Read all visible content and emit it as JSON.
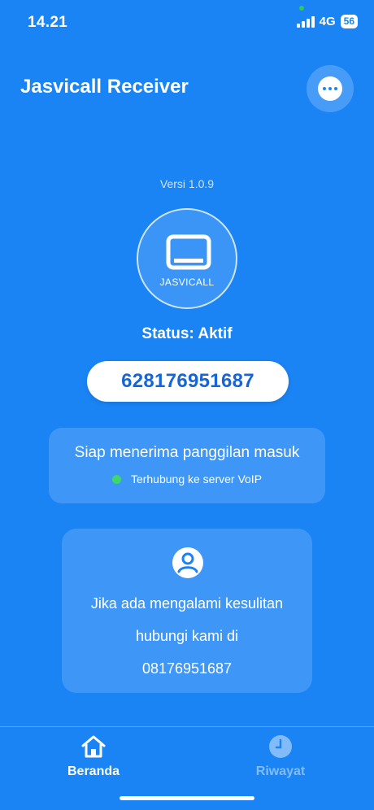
{
  "status_bar": {
    "time": "14.21",
    "network": "4G",
    "battery": "56"
  },
  "header": {
    "title": "Jasvicall Receiver",
    "more_icon": "more-dots-icon"
  },
  "version": "Versi 1.0.9",
  "logo": {
    "icon": "tablet-icon",
    "text": "JASVICALL"
  },
  "status_text": "Status: Aktif",
  "phone_number": "628176951687",
  "ready_card": {
    "title": "Siap menerima panggilan masuk",
    "connection": "Terhubung ke server VoIP",
    "connection_color": "#3fd66a"
  },
  "contact_card": {
    "icon": "person-icon",
    "line1": "Jika ada mengalami kesulitan",
    "line2": "hubungi kami di",
    "line3": "08176951687"
  },
  "nav": {
    "home_label": "Beranda",
    "history_label": "Riwayat"
  },
  "colors": {
    "background": "#1a84f5",
    "accent_text": "#1565d8"
  }
}
